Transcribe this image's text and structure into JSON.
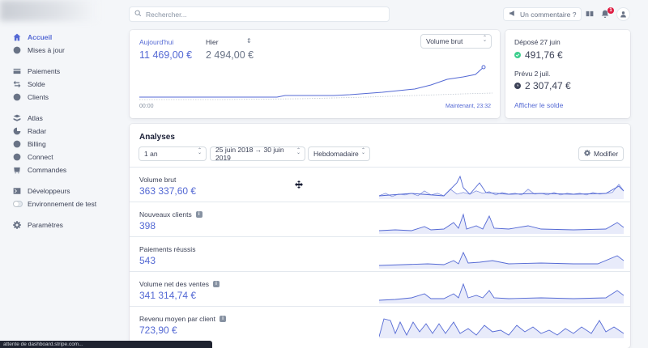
{
  "topbar": {
    "search_placeholder": "Rechercher...",
    "feedback_label": "Un commentaire ?",
    "notifications_count": "1"
  },
  "sidebar": {
    "groups": [
      [
        {
          "label": "Accueil",
          "icon": "home-icon",
          "active": true
        },
        {
          "label": "Mises à jour",
          "icon": "updates-icon"
        }
      ],
      [
        {
          "label": "Paiements",
          "icon": "card-icon"
        },
        {
          "label": "Solde",
          "icon": "transfer-icon"
        },
        {
          "label": "Clients",
          "icon": "user-icon"
        }
      ],
      [
        {
          "label": "Atlas",
          "icon": "atlas-icon"
        },
        {
          "label": "Radar",
          "icon": "radar-icon"
        },
        {
          "label": "Billing",
          "icon": "billing-icon"
        },
        {
          "label": "Connect",
          "icon": "connect-icon"
        },
        {
          "label": "Commandes",
          "icon": "orders-icon"
        }
      ],
      [
        {
          "label": "Développeurs",
          "icon": "terminal-icon"
        },
        {
          "label": "Environnement de test",
          "icon": "toggle-icon"
        }
      ],
      [
        {
          "label": "Paramètres",
          "icon": "gear-icon"
        }
      ]
    ]
  },
  "today": {
    "today_label": "Aujourd'hui",
    "today_value": "11 469,00 €",
    "yesterday_label": "Hier",
    "yesterday_value": "2 494,00 €",
    "metric_select": "Volume brut",
    "time_start": "00:00",
    "time_now": "Maintenant, 23:32"
  },
  "balance": {
    "deposited_label": "Déposé 27 juin",
    "deposited_value": "491,76 €",
    "expected_label": "Prévu 2 juil.",
    "expected_value": "2 307,47 €",
    "link_label": "Afficher le solde"
  },
  "analyses": {
    "title": "Analyses",
    "range_select": "1 an",
    "date_range": "25 juin 2018 → 30 juin 2019",
    "interval_select": "Hebdomadaire",
    "modify_label": "Modifier",
    "metrics": [
      {
        "name": "Volume brut",
        "value": "363 337,60 €",
        "info": false
      },
      {
        "name": "Nouveaux clients",
        "value": "398",
        "info": true
      },
      {
        "name": "Paiements réussis",
        "value": "543",
        "info": false
      },
      {
        "name": "Volume net des ventes",
        "value": "341 314,74 €",
        "info": true
      },
      {
        "name": "Revenu moyen par client",
        "value": "723,90 €",
        "info": true
      }
    ]
  },
  "statusbar": {
    "text": "attente de dashboard.stripe.com..."
  },
  "colors": {
    "accent": "#5469d4",
    "success": "#3ecf8e"
  }
}
